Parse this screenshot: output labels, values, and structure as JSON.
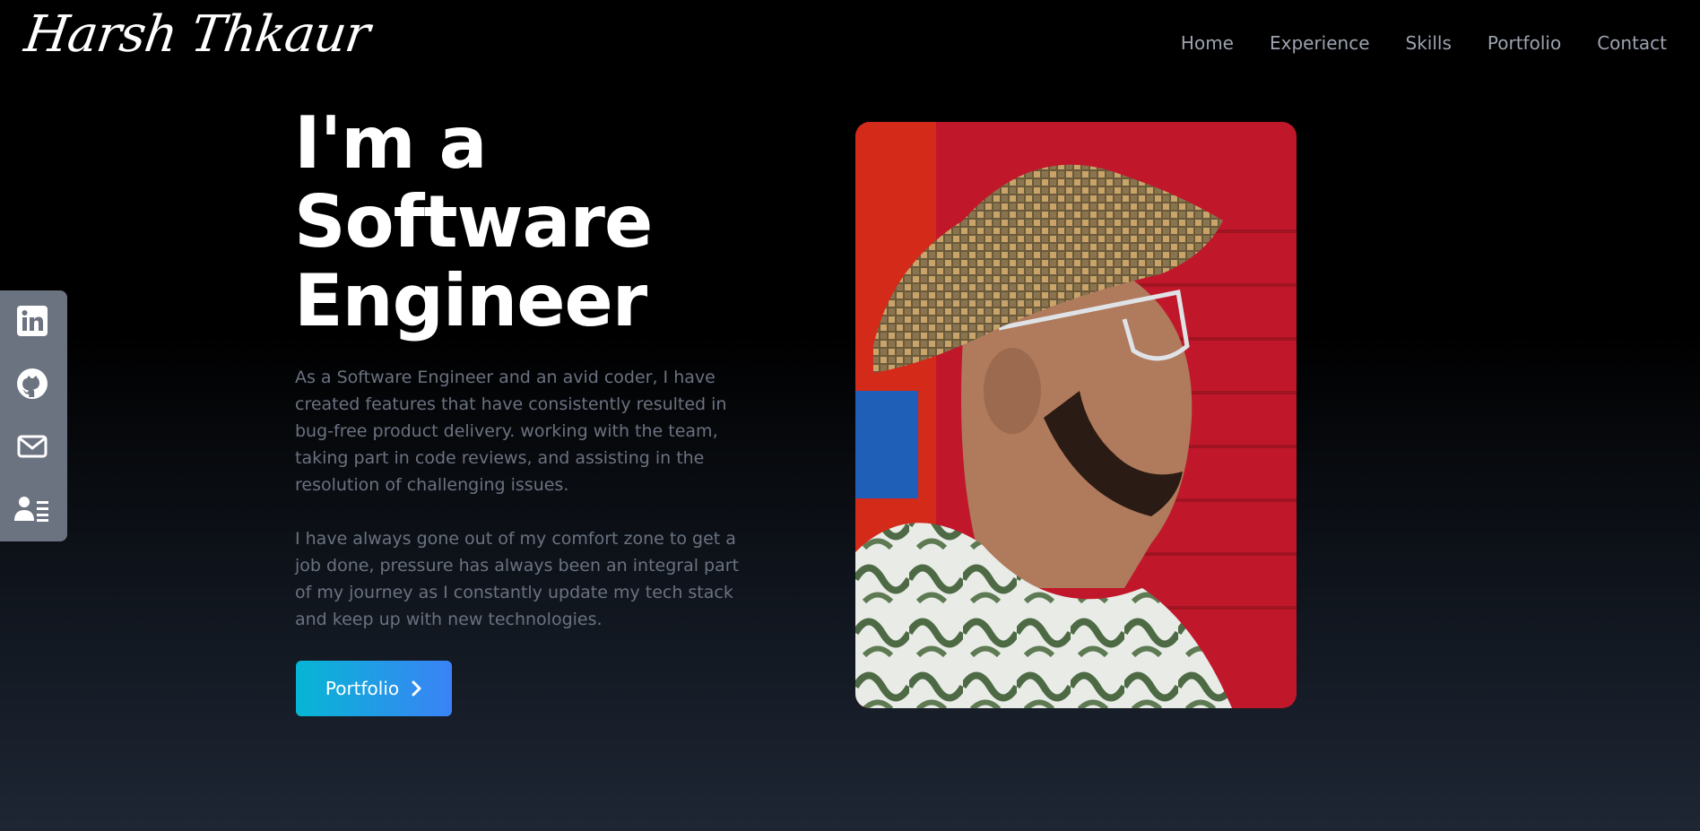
{
  "header": {
    "logo_text": "Harsh Thkaur",
    "nav": [
      {
        "label": "Home"
      },
      {
        "label": "Experience"
      },
      {
        "label": "Skills"
      },
      {
        "label": "Portfolio"
      },
      {
        "label": "Contact"
      }
    ]
  },
  "social": {
    "items": [
      {
        "icon": "linkedin-icon"
      },
      {
        "icon": "github-icon"
      },
      {
        "icon": "mail-icon"
      },
      {
        "icon": "resume-icon"
      }
    ],
    "background": "#6b7280"
  },
  "hero": {
    "title_lines": [
      "I'm a",
      "Software",
      "Engineer"
    ],
    "paragraph_1": "As a Software Engineer and an avid coder, I have created features that have consistently resulted in bug-free product delivery. working with the team, taking part in code reviews, and assisting in the resolution of challenging issues.",
    "paragraph_2": "I have always gone out of my comfort zone to get a job done, pressure has always been an integral part of my journey as I constantly update my tech stack and keep up with new technologies.",
    "cta_label": "Portfolio",
    "cta_icon": "chevron-right-icon"
  },
  "colors": {
    "accent_start": "#06b6d4",
    "accent_end": "#3b82f6",
    "nav_text": "#9ca3af",
    "body_text": "#6b7280"
  }
}
